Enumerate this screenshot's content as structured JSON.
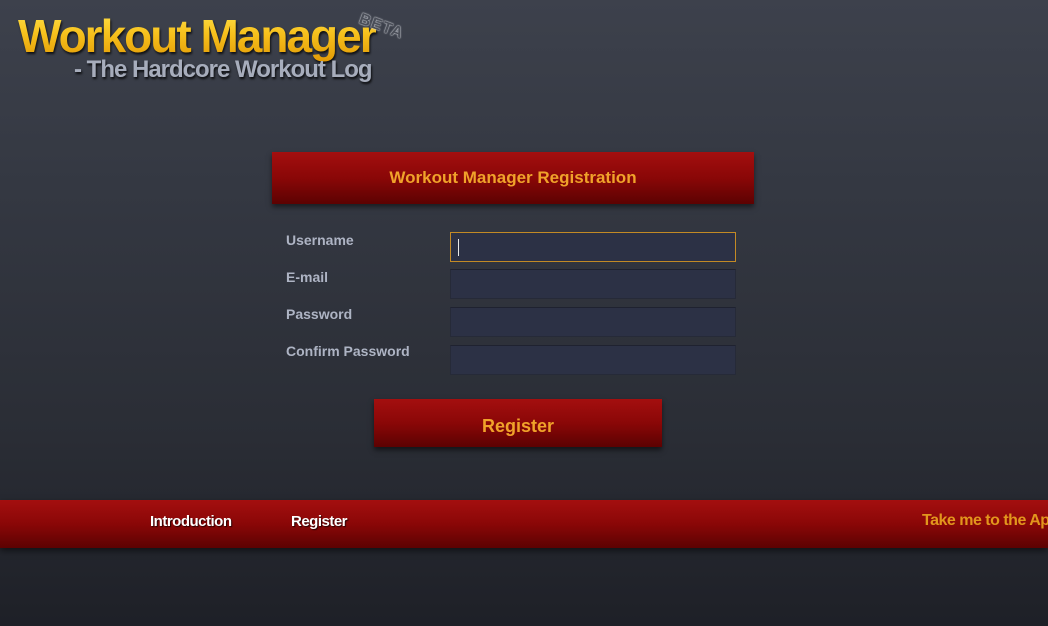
{
  "logo": {
    "title": "Workout Manager",
    "badge": "BETA",
    "subtitle": "- The Hardcore Workout Log"
  },
  "registration": {
    "heading": "Workout Manager Registration",
    "fields": [
      {
        "label": "Username",
        "value": "",
        "focused": true
      },
      {
        "label": "E-mail",
        "value": ""
      },
      {
        "label": "Password",
        "value": ""
      },
      {
        "label": "Confirm Password",
        "value": ""
      }
    ],
    "submit_label": "Register"
  },
  "footer_nav": {
    "items": [
      {
        "label": "Introduction"
      },
      {
        "label": "Register"
      }
    ],
    "app_link": "Take me to the Ap"
  },
  "colors": {
    "accent_red": "#8a0707",
    "accent_gold": "#f0a22a",
    "background": "#2a2d35",
    "input_bg": "#2c3145"
  }
}
